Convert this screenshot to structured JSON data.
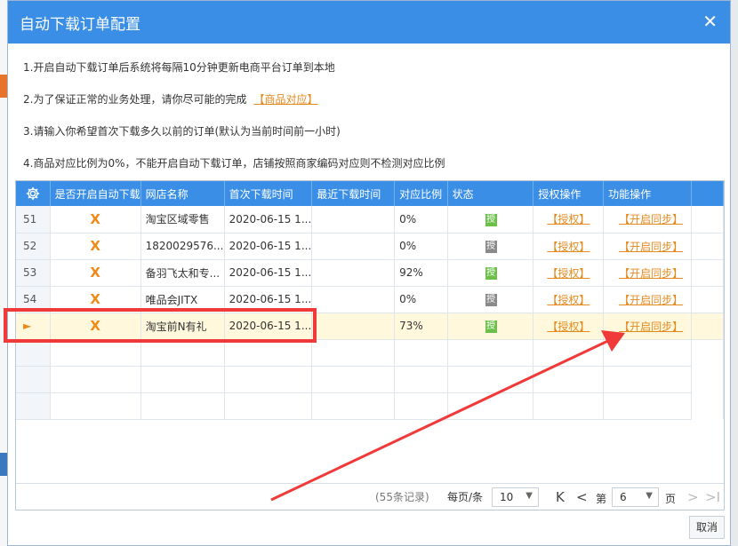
{
  "dialog": {
    "title": "自动下载订单配置",
    "close_glyph": "✕"
  },
  "notes": [
    {
      "text": "1.开启自动下载订单后系统将每隔10分钟更新电商平台订单到本地"
    },
    {
      "text": "2.为了保证正常的业务处理，请你尽可能的完成",
      "link": "【商品对应】"
    },
    {
      "text": "3.请输入你希望首次下载多久以前的订单(默认为当前时间前一小时)"
    },
    {
      "text": "4.商品对应比例为0%，不能开启自动下载订单，店铺按照商家编码对应则不检测对应比例"
    }
  ],
  "grid": {
    "columns": [
      "",
      "是否开启自动下载",
      "网店名称",
      "首次下载时间",
      "最近下载时间",
      "对应比例",
      "状态",
      "授权操作",
      "功能操作"
    ],
    "rows": [
      {
        "num": "51",
        "auto": "X",
        "shop": "淘宝区域零售",
        "first": "2020-06-15 1...",
        "last": "",
        "ratio": "0%",
        "status": "授",
        "status_color": "#6cc04a",
        "auth": "【授权】",
        "func": "【开启同步】",
        "selected": false
      },
      {
        "num": "52",
        "auto": "X",
        "shop": "1820029576...",
        "first": "2020-06-15 1...",
        "last": "",
        "ratio": "0%",
        "status": "授",
        "status_color": "#8a8a8a",
        "auth": "【授权】",
        "func": "【开启同步】",
        "selected": false
      },
      {
        "num": "53",
        "auto": "X",
        "shop": "备羽飞太和专...",
        "first": "2020-06-15 1...",
        "last": "",
        "ratio": "92%",
        "status": "授",
        "status_color": "#6cc04a",
        "auth": "【授权】",
        "func": "【开启同步】",
        "selected": false
      },
      {
        "num": "54",
        "auto": "X",
        "shop": "唯品会JITX",
        "first": "2020-06-15 1...",
        "last": "",
        "ratio": "0%",
        "status": "授",
        "status_color": "#8a8a8a",
        "auth": "【授权】",
        "func": "【开启同步】",
        "selected": false
      },
      {
        "num": "►",
        "auto": "X",
        "shop": "淘宝前N有礼",
        "first": "2020-06-15 1...",
        "last": "",
        "ratio": "73%",
        "status": "授",
        "status_color": "#6cc04a",
        "auth": "【授权】",
        "func": "【开启同步】",
        "selected": true
      }
    ]
  },
  "pager": {
    "records": "(55条记录)",
    "per_page_label": "每页/条",
    "per_page_value": "10",
    "first_glyph": "K",
    "prev_glyph": "<",
    "page_prefix": "第",
    "page_value": "6",
    "page_suffix": "页",
    "next_glyph": ">",
    "last_glyph": ">I"
  },
  "footer": {
    "cancel_label": "取消"
  },
  "annotation": {
    "highlight_color": "#f03a3a"
  }
}
